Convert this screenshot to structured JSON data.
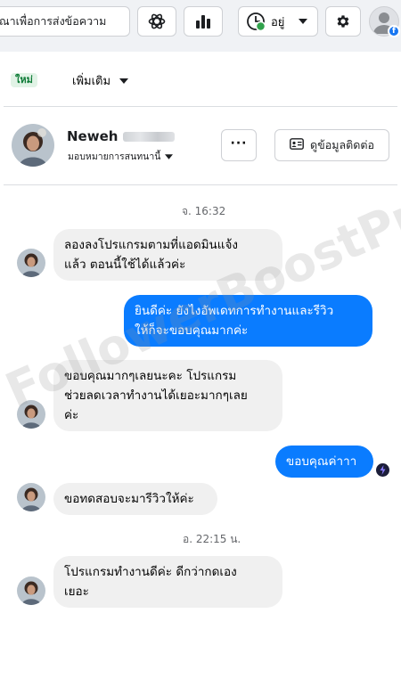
{
  "topbar": {
    "search_placeholder": "ณาเพื่อการส่งข้อความ",
    "status_label": "อยู่"
  },
  "filter": {
    "new_tag": "ใหม่",
    "more_label": "เพิ่มเติม"
  },
  "contact": {
    "name": "Neweh",
    "assignee_label": "มอบหมายการสนทนานี้",
    "more_label": "···",
    "view_info_label": "ดูข้อมูลติดต่อ"
  },
  "watermark": "FollowerBoostPro",
  "messages": [
    {
      "type": "time",
      "text": "จ. 16:32"
    },
    {
      "type": "in",
      "lines": [
        "ลองลงโปรแกรมตามที่แอดมินแจ้ง",
        "แล้ว ตอนนี้ใช้ได้แล้วค่ะ"
      ]
    },
    {
      "type": "out",
      "lines": [
        "ยินดีค่ะ ยังไงอัพเดทการทำงานและรีวิว",
        "ให้ก็จะขอบคุณมากค่ะ"
      ]
    },
    {
      "type": "in",
      "lines": [
        "ขอบคุณมากๆเลยนะคะ โปรแกรม",
        "ช่วยลดเวลาทำงานได้เยอะมากๆเลย",
        "ค่ะ"
      ]
    },
    {
      "type": "out",
      "lines": [
        "ขอบคุณค่าาา"
      ]
    },
    {
      "type": "in",
      "lines": [
        "ขอทดสอบจะมารีวิวให้ค่ะ"
      ]
    },
    {
      "type": "time",
      "text": "อ. 22:15 น."
    },
    {
      "type": "in",
      "lines": [
        "โปรแกรมทำงานดีค่ะ ดีกว่ากดเอง",
        "เยอะ"
      ]
    }
  ],
  "colors": {
    "outgoing_bubble": "#0a7cff",
    "incoming_bubble": "#f0f0f0",
    "online_dot": "#31a24c",
    "new_tag_bg": "#e1f3e6",
    "new_tag_text": "#0d7a36"
  },
  "icons": [
    "meta-ai-icon",
    "insights-icon",
    "status-clock-icon",
    "caret-down-icon",
    "gear-icon",
    "user-avatar-icon",
    "facebook-badge-icon",
    "id-card-icon",
    "seen-avatar-icon"
  ]
}
